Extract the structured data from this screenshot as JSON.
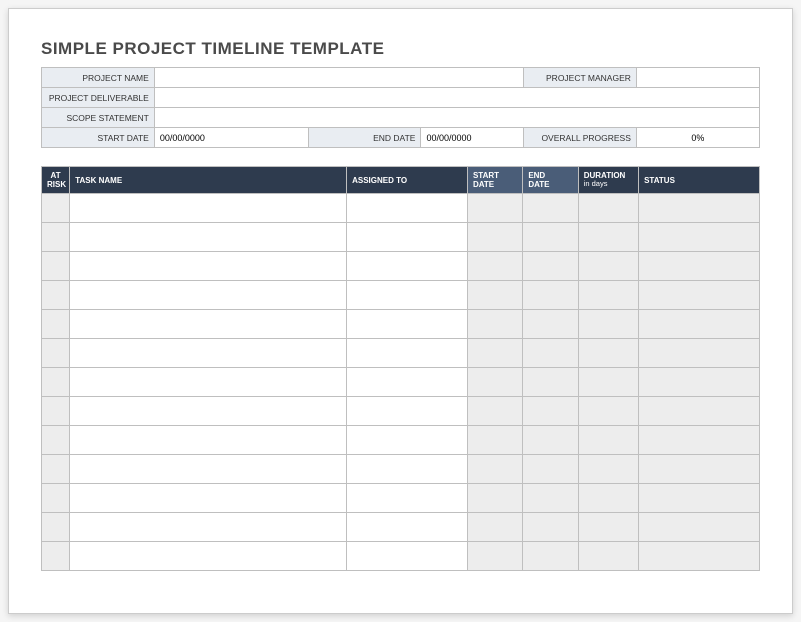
{
  "title": "SIMPLE PROJECT TIMELINE TEMPLATE",
  "meta": {
    "project_name_label": "PROJECT NAME",
    "project_name_value": "",
    "project_manager_label": "PROJECT MANAGER",
    "project_manager_value": "",
    "project_deliverable_label": "PROJECT DELIVERABLE",
    "project_deliverable_value": "",
    "scope_statement_label": "SCOPE STATEMENT",
    "scope_statement_value": "",
    "start_date_label": "START DATE",
    "start_date_value": "00/00/0000",
    "end_date_label": "END DATE",
    "end_date_value": "00/00/0000",
    "overall_progress_label": "OVERALL PROGRESS",
    "overall_progress_value": "0%"
  },
  "headers": {
    "at_risk": "AT\nRISK",
    "task_name": "TASK NAME",
    "assigned_to": "ASSIGNED TO",
    "start_date": "START\nDATE",
    "end_date": "END\nDATE",
    "duration": "DURATION",
    "duration_sub": "in days",
    "status": "STATUS"
  },
  "rows": [
    {
      "at_risk": "",
      "task_name": "",
      "assigned_to": "",
      "start_date": "",
      "end_date": "",
      "duration": "",
      "status": ""
    },
    {
      "at_risk": "",
      "task_name": "",
      "assigned_to": "",
      "start_date": "",
      "end_date": "",
      "duration": "",
      "status": ""
    },
    {
      "at_risk": "",
      "task_name": "",
      "assigned_to": "",
      "start_date": "",
      "end_date": "",
      "duration": "",
      "status": ""
    },
    {
      "at_risk": "",
      "task_name": "",
      "assigned_to": "",
      "start_date": "",
      "end_date": "",
      "duration": "",
      "status": ""
    },
    {
      "at_risk": "",
      "task_name": "",
      "assigned_to": "",
      "start_date": "",
      "end_date": "",
      "duration": "",
      "status": ""
    },
    {
      "at_risk": "",
      "task_name": "",
      "assigned_to": "",
      "start_date": "",
      "end_date": "",
      "duration": "",
      "status": ""
    },
    {
      "at_risk": "",
      "task_name": "",
      "assigned_to": "",
      "start_date": "",
      "end_date": "",
      "duration": "",
      "status": ""
    },
    {
      "at_risk": "",
      "task_name": "",
      "assigned_to": "",
      "start_date": "",
      "end_date": "",
      "duration": "",
      "status": ""
    },
    {
      "at_risk": "",
      "task_name": "",
      "assigned_to": "",
      "start_date": "",
      "end_date": "",
      "duration": "",
      "status": ""
    },
    {
      "at_risk": "",
      "task_name": "",
      "assigned_to": "",
      "start_date": "",
      "end_date": "",
      "duration": "",
      "status": ""
    },
    {
      "at_risk": "",
      "task_name": "",
      "assigned_to": "",
      "start_date": "",
      "end_date": "",
      "duration": "",
      "status": ""
    },
    {
      "at_risk": "",
      "task_name": "",
      "assigned_to": "",
      "start_date": "",
      "end_date": "",
      "duration": "",
      "status": ""
    },
    {
      "at_risk": "",
      "task_name": "",
      "assigned_to": "",
      "start_date": "",
      "end_date": "",
      "duration": "",
      "status": ""
    }
  ]
}
